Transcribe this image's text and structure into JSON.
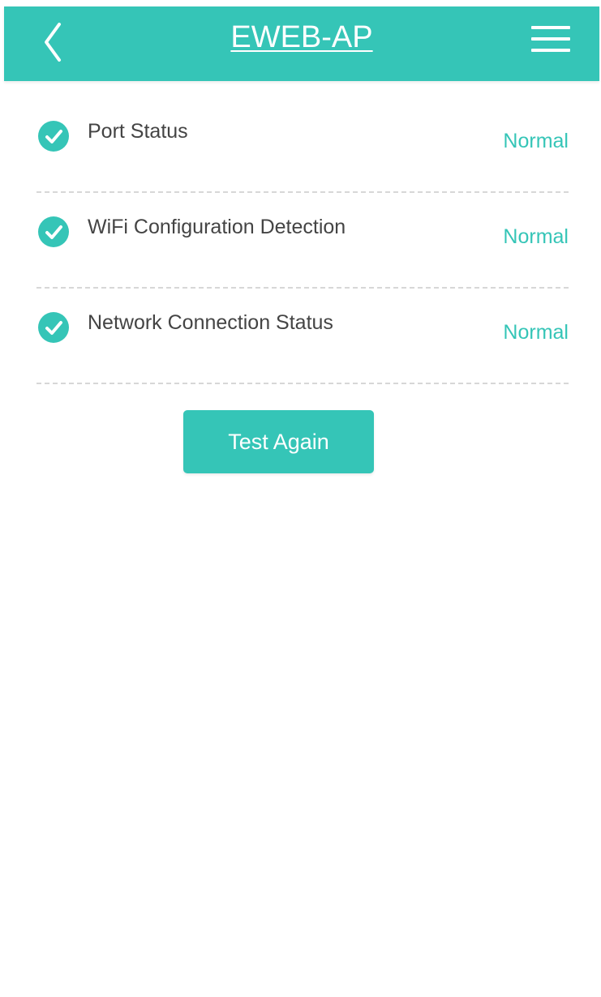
{
  "header": {
    "title": "EWEB-AP",
    "back_icon": "chevron-left-icon",
    "menu_icon": "hamburger-menu-icon",
    "background_color": "#35c5b7"
  },
  "checks": [
    {
      "label": "Port Status",
      "status": "Normal",
      "icon": "check-circle-icon"
    },
    {
      "label": "WiFi Configuration Detection",
      "status": "Normal",
      "icon": "check-circle-icon"
    },
    {
      "label": "Network Connection Status",
      "status": "Normal",
      "icon": "check-circle-icon"
    }
  ],
  "actions": {
    "test_again_label": "Test Again"
  },
  "colors": {
    "accent": "#35c5b7",
    "label_text": "#444444",
    "divider": "#d7d7d7"
  }
}
